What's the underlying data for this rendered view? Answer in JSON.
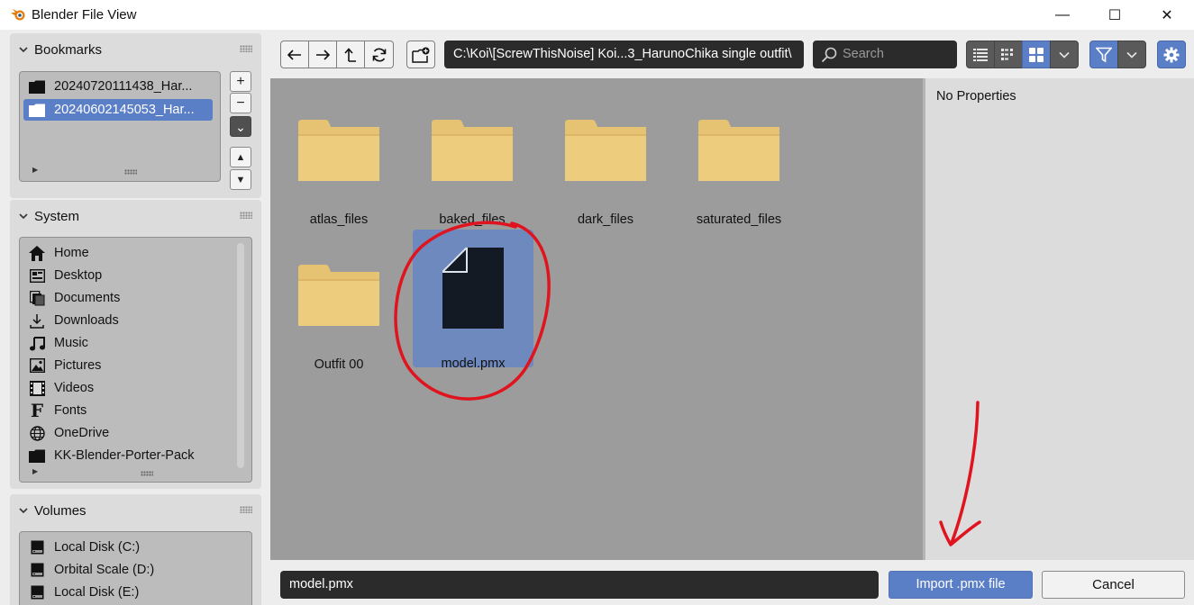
{
  "window": {
    "title": "Blender File View",
    "minimize_glyph": "—",
    "maximize_glyph": "☐",
    "close_glyph": "✕"
  },
  "bookmarks": {
    "title": "Bookmarks",
    "items": [
      {
        "label": "20240720111438_Har...",
        "selected": false
      },
      {
        "label": "20240602145053_Har...",
        "selected": true
      }
    ],
    "add_glyph": "+",
    "remove_glyph": "−",
    "menu_glyph": "⌄",
    "up_glyph": "▲",
    "down_glyph": "▼"
  },
  "system": {
    "title": "System",
    "items": [
      {
        "label": "Home",
        "icon": "home-icon"
      },
      {
        "label": "Desktop",
        "icon": "desktop-icon"
      },
      {
        "label": "Documents",
        "icon": "documents-icon"
      },
      {
        "label": "Downloads",
        "icon": "download-icon"
      },
      {
        "label": "Music",
        "icon": "music-icon"
      },
      {
        "label": "Pictures",
        "icon": "pictures-icon"
      },
      {
        "label": "Videos",
        "icon": "videos-icon"
      },
      {
        "label": "Fonts",
        "icon": "fonts-icon"
      },
      {
        "label": "OneDrive",
        "icon": "globe-icon"
      },
      {
        "label": "KK-Blender-Porter-Pack",
        "icon": "folder-icon"
      }
    ]
  },
  "volumes": {
    "title": "Volumes",
    "items": [
      {
        "label": "Local Disk (C:)",
        "icon": "disk-icon"
      },
      {
        "label": "Orbital Scale (D:)",
        "icon": "disk-icon"
      },
      {
        "label": "Local Disk (E:)",
        "icon": "disk-icon"
      }
    ]
  },
  "toolbar": {
    "path": "C:\\Koi\\[ScrewThisNoise] Koi...3_HarunoChika single outfit\\",
    "search_placeholder": "Search"
  },
  "files": [
    {
      "name": "atlas_files",
      "type": "folder",
      "selected": false
    },
    {
      "name": "baked_files",
      "type": "folder",
      "selected": false
    },
    {
      "name": "dark_files",
      "type": "folder",
      "selected": false
    },
    {
      "name": "saturated_files",
      "type": "folder",
      "selected": false
    },
    {
      "name": "Outfit 00",
      "type": "folder",
      "selected": false
    },
    {
      "name": "model.pmx",
      "type": "file",
      "selected": true
    }
  ],
  "properties": {
    "text": "No Properties"
  },
  "bottom": {
    "filename": "model.pmx",
    "import_label": "Import .pmx file",
    "cancel_label": "Cancel"
  },
  "colors": {
    "accent": "#5b7fc7",
    "folder": "#e6c373",
    "annotation": "#e0141e"
  }
}
